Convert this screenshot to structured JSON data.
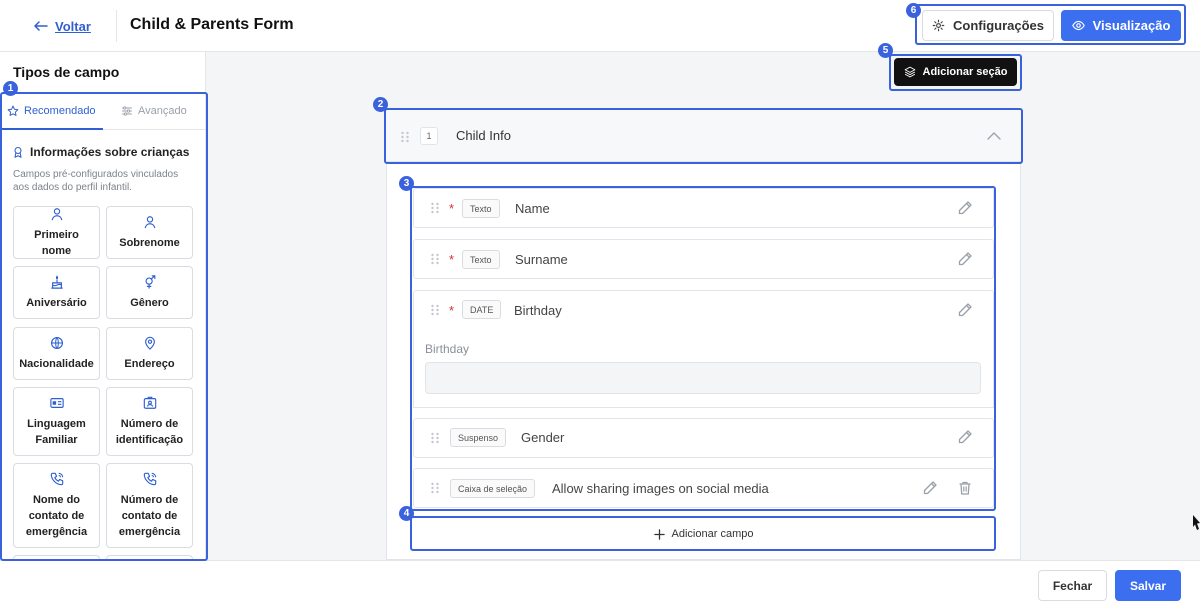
{
  "header": {
    "back_label": "Voltar",
    "form_title": "Child & Parents Form",
    "config_label": "Configurações",
    "preview_label": "Visualização"
  },
  "markers": [
    "1",
    "2",
    "3",
    "4",
    "5",
    "6"
  ],
  "sidebar": {
    "title": "Tipos de campo",
    "tabs": [
      {
        "label": "Recomendado",
        "active": true
      },
      {
        "label": "Avançado",
        "active": false
      }
    ],
    "category_title": "Informações sobre crianças",
    "category_desc": "Campos pré-configurados vinculados aos dados do perfil infantil.",
    "fields": [
      {
        "label": "Primeiro nome",
        "icon": "person-icon"
      },
      {
        "label": "Sobrenome",
        "icon": "person-icon"
      },
      {
        "label": "Aniversário",
        "icon": "cake-icon"
      },
      {
        "label": "Gênero",
        "icon": "gender-icon"
      },
      {
        "label": "Nacionalidade",
        "icon": "globe-icon"
      },
      {
        "label": "Endereço",
        "icon": "map-pin-icon"
      },
      {
        "label": "Linguagem Familiar",
        "icon": "language-icon"
      },
      {
        "label": "Número de identificação",
        "icon": "id-card-icon"
      },
      {
        "label": "Nome do contato de emergência",
        "icon": "phone-icon"
      },
      {
        "label": "Número de contato de emergência",
        "icon": "phone-icon"
      }
    ]
  },
  "canvas": {
    "add_section_label": "Adicionar seção",
    "section": {
      "number": "1",
      "title": "Child Info"
    },
    "fields": [
      {
        "type": "Texto",
        "label": "Name",
        "required": "*"
      },
      {
        "type": "Texto",
        "label": "Surname",
        "required": "*"
      },
      {
        "type": "DATE",
        "label": "Birthday",
        "required": "*",
        "preview_label": "Birthday"
      },
      {
        "type": "Suspenso",
        "label": "Gender",
        "required": ""
      },
      {
        "type": "Caixa de seleção",
        "label": "Allow sharing images on social media",
        "required": ""
      }
    ],
    "add_field_label": "Adicionar campo"
  },
  "footer": {
    "close_label": "Fechar",
    "save_label": "Salvar"
  },
  "colors": {
    "accent": "#3b6ff0",
    "annotation": "#3b62dd",
    "required": "#d93030"
  }
}
